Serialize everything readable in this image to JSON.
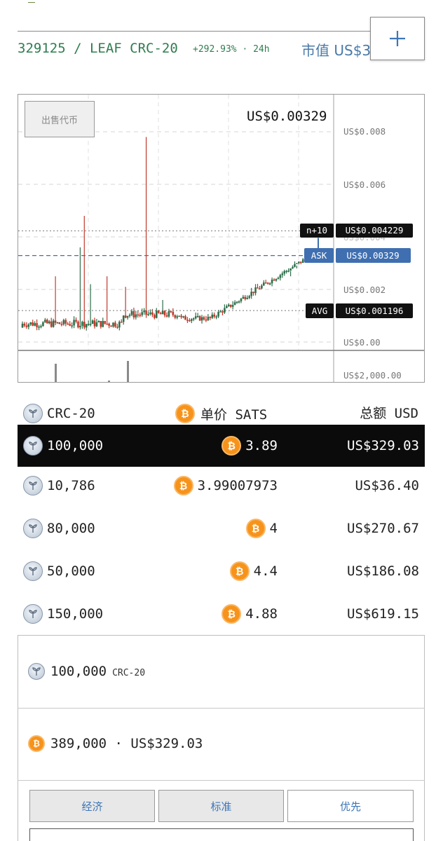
{
  "header": {
    "ticker": "329125 / LEAF CRC-20",
    "change": "+292.93% · 24h",
    "market_cap_label": "市值 US$3"
  },
  "chart": {
    "sell_button": "出售代币",
    "last_price": "US$0.00329",
    "y_ticks": [
      "US$0.008",
      "US$0.006",
      "US$0.004",
      "US$0.002",
      "US$0.00"
    ],
    "volume_tick": "US$2,000.00",
    "markers": [
      {
        "tag": "n+10",
        "value": "US$0.004229"
      },
      {
        "tag": "ASK",
        "value": "US$0.00329"
      },
      {
        "tag": "AVG",
        "value": "US$0.001196"
      }
    ]
  },
  "chart_data": {
    "type": "candlestick",
    "ylim": [
      0,
      0.0093
    ],
    "y_ticks": [
      0,
      0.002,
      0.004,
      0.006,
      0.008
    ],
    "reference_lines": {
      "n+10": 0.004229,
      "ask": 0.00329,
      "avg": 0.001196
    },
    "colors": {
      "up": "#2f6f4a",
      "down": "#c0392b",
      "ask": "#3f6fb0"
    }
  },
  "orderbook": {
    "headers": {
      "qty": "CRC-20",
      "price": "单价 SATS",
      "total": "总额 USD"
    },
    "rows": [
      {
        "qty": "100,000",
        "price": "3.89",
        "total": "US$329.03",
        "selected": true
      },
      {
        "qty": "10,786",
        "price": "3.99007973",
        "total": "US$36.40",
        "selected": false
      },
      {
        "qty": "80,000",
        "price": "4",
        "total": "US$270.67",
        "selected": false
      },
      {
        "qty": "50,000",
        "price": "4.4",
        "total": "US$186.08",
        "selected": false
      },
      {
        "qty": "150,000",
        "price": "4.88",
        "total": "US$619.15",
        "selected": false
      }
    ]
  },
  "amount": {
    "token_amount": "100,000",
    "token_unit": "CRC-20",
    "btc_amount": "389,000 · US$329.03"
  },
  "fees": {
    "tabs": [
      {
        "label": "经济",
        "active": false
      },
      {
        "label": "标准",
        "active": false
      },
      {
        "label": "优先",
        "active": true
      }
    ]
  },
  "icons": {
    "leaf": "leaf-token-icon",
    "btc": "bitcoin-icon",
    "add": "plus-icon"
  },
  "colors": {
    "accent_green": "#2f7d4f",
    "link_blue": "#3d76b8",
    "bitcoin_orange": "#f7931a"
  }
}
